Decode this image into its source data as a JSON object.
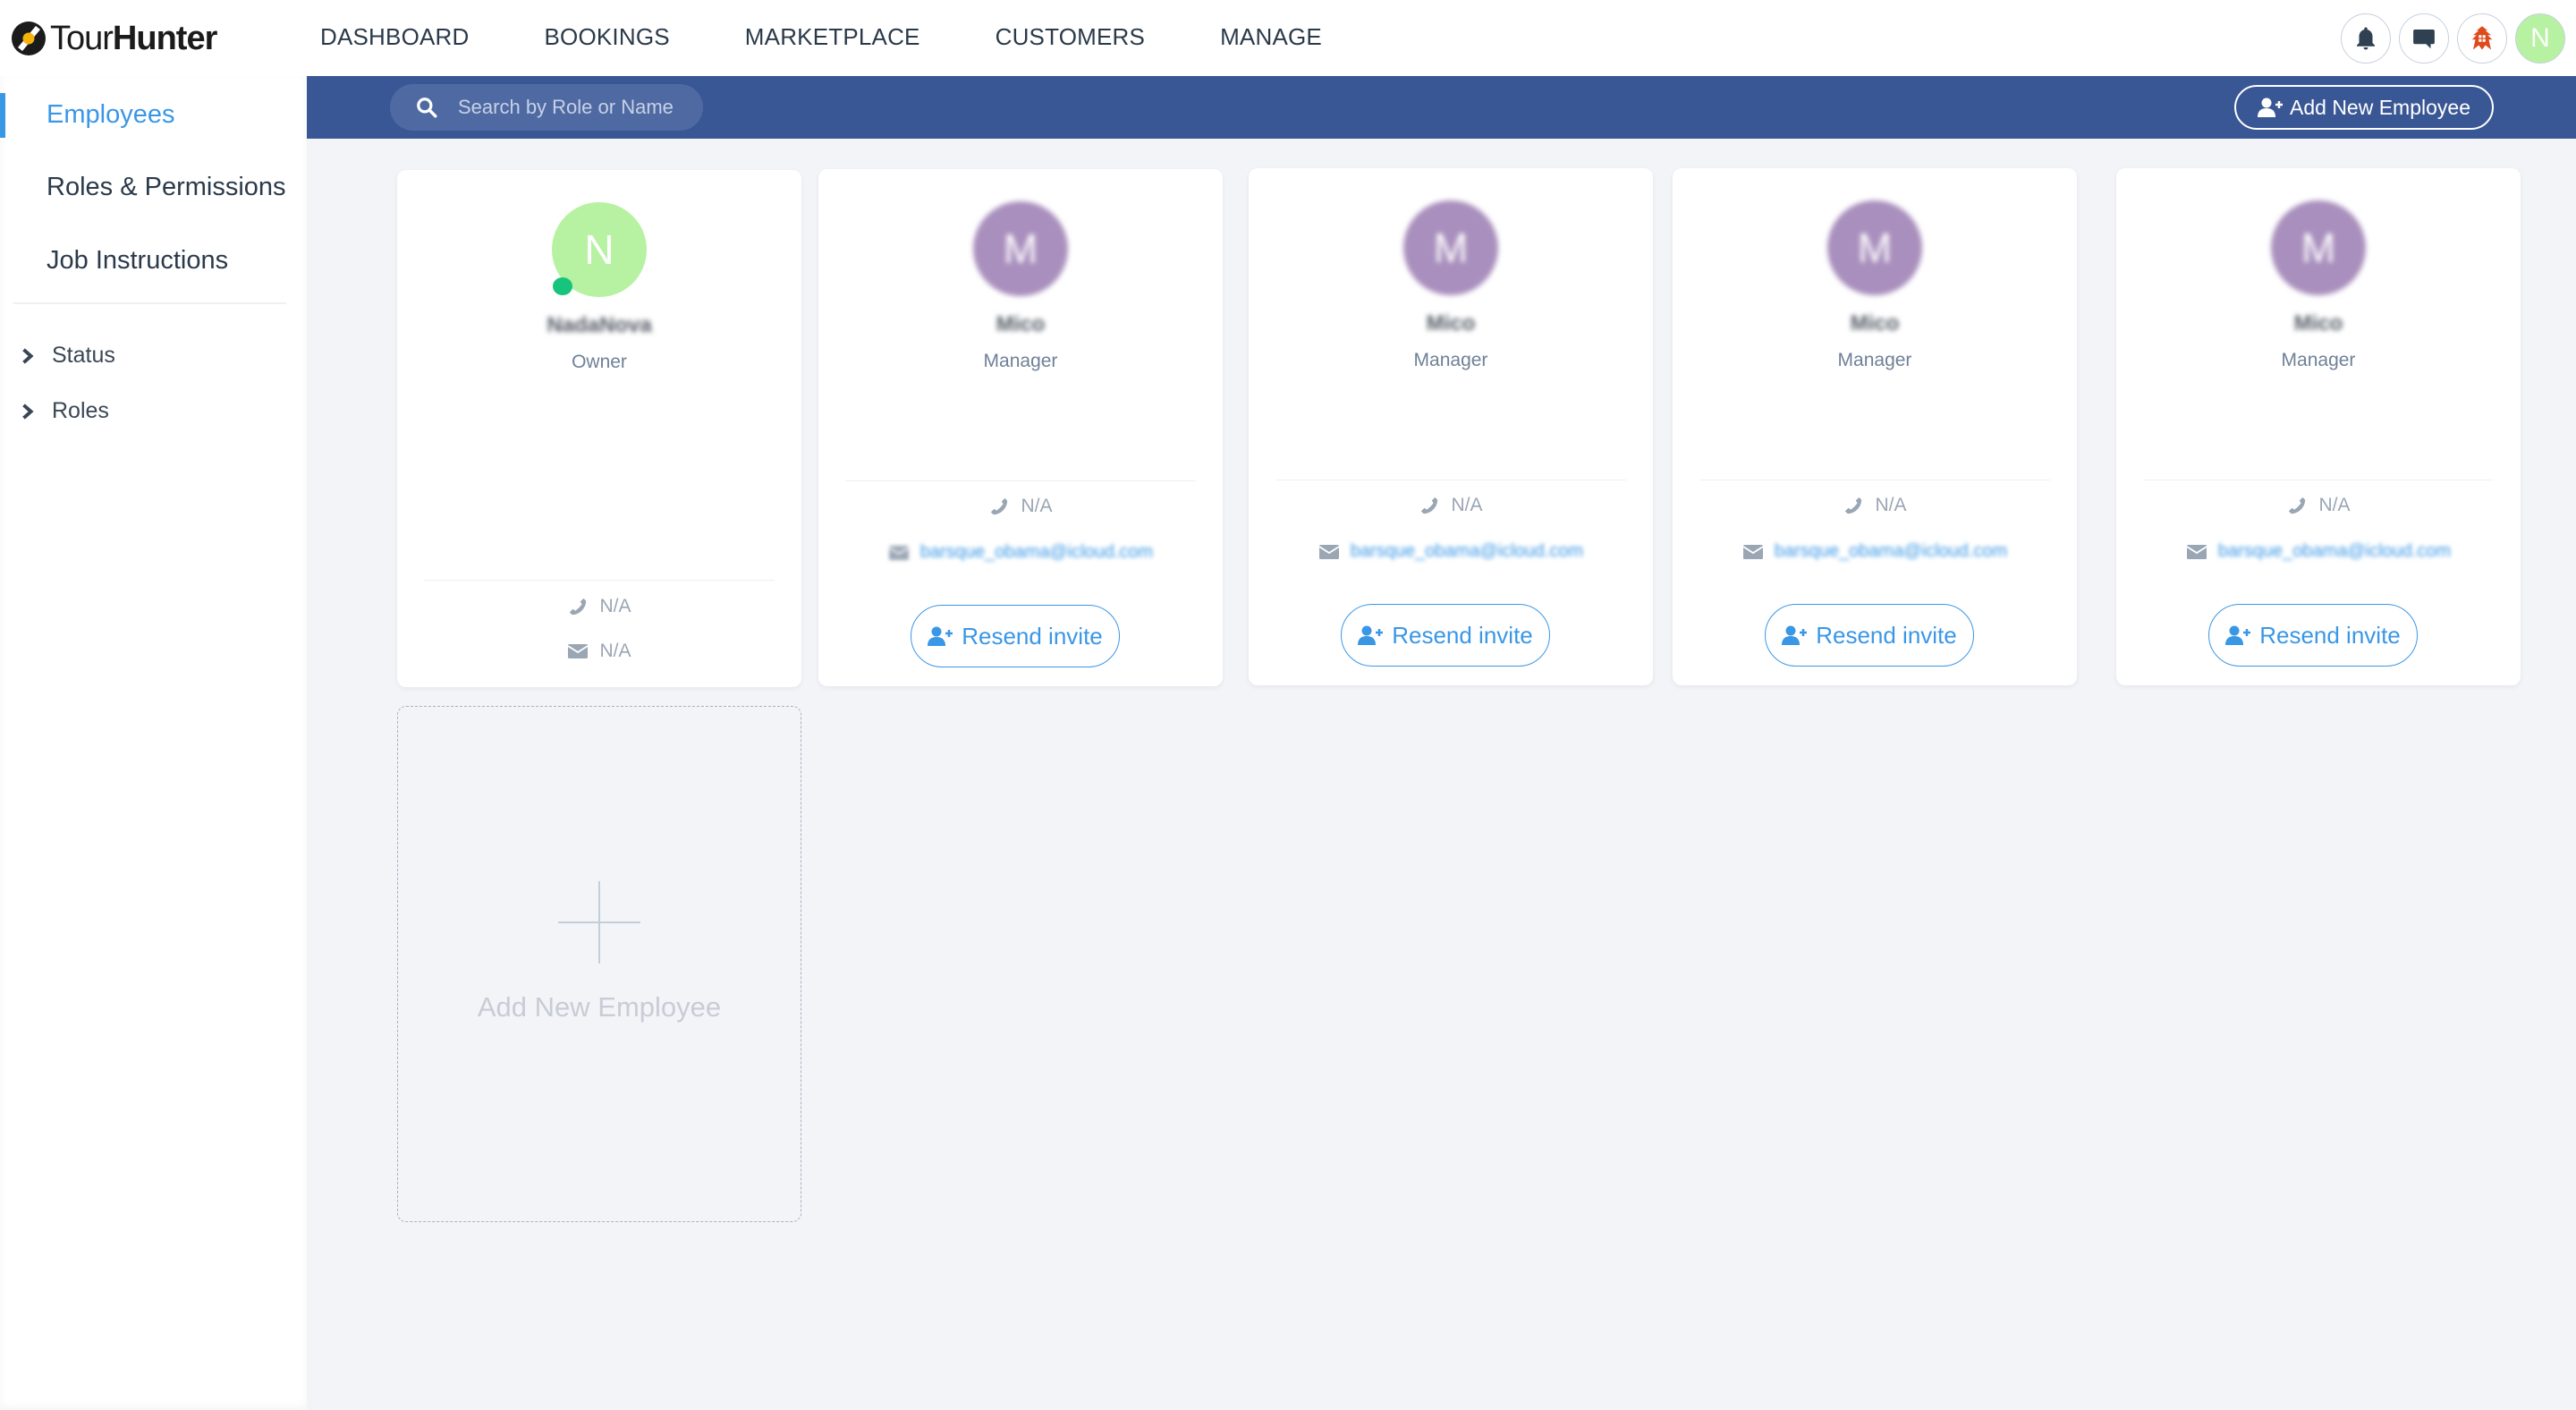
{
  "app": {
    "brand_light": "Tour",
    "brand_bold": "Hunter"
  },
  "nav": {
    "items": [
      {
        "label": "DASHBOARD"
      },
      {
        "label": "BOOKINGS"
      },
      {
        "label": "MARKETPLACE"
      },
      {
        "label": "CUSTOMERS"
      },
      {
        "label": "MANAGE"
      }
    ]
  },
  "header_icons": {
    "notifications": "bell-icon",
    "messages": "chat-icon",
    "company_logo": "company-logo",
    "user_initial": "N"
  },
  "sidebar": {
    "items": [
      {
        "label": "Employees",
        "active": true
      },
      {
        "label": "Roles & Permissions",
        "active": false
      },
      {
        "label": "Job Instructions",
        "active": false
      }
    ],
    "filters": [
      {
        "label": "Status"
      },
      {
        "label": "Roles"
      }
    ]
  },
  "toolbar": {
    "search_placeholder": "Search by Role or Name",
    "search_value": "",
    "add_button_label": "Add New Employee"
  },
  "employees": [
    {
      "initial": "N",
      "name": "NadaNova",
      "role": "Owner",
      "phone": "N/A",
      "email": "N/A",
      "online": true,
      "resend_label": null
    },
    {
      "initial": "M",
      "name": "Mico",
      "role": "Manager",
      "phone": "N/A",
      "email": "barsque_obama@icloud.com",
      "online": false,
      "resend_label": "Resend invite"
    },
    {
      "initial": "M",
      "name": "Mico",
      "role": "Manager",
      "phone": "N/A",
      "email": "barsque_obama@icloud.com",
      "online": false,
      "resend_label": "Resend invite"
    },
    {
      "initial": "M",
      "name": "Mico",
      "role": "Manager",
      "phone": "N/A",
      "email": "barsque_obama@icloud.com",
      "online": false,
      "resend_label": "Resend invite"
    },
    {
      "initial": "M",
      "name": "Mico",
      "role": "Manager",
      "phone": "N/A",
      "email": "barsque_obama@icloud.com",
      "online": false,
      "resend_label": "Resend invite"
    }
  ],
  "add_card": {
    "label": "Add New Employee"
  },
  "colors": {
    "accent": "#3a97e6",
    "toolbar": "#3a5795",
    "online": "#17c47c",
    "owner_avatar": "#b7f1a2",
    "member_avatar": "#a98fbd"
  }
}
